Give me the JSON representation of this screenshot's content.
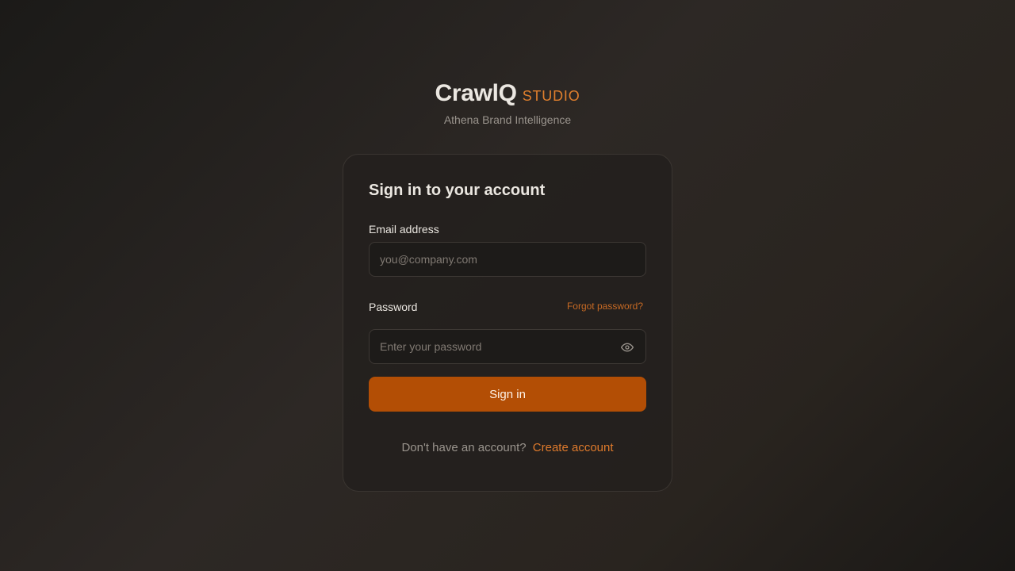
{
  "brand": {
    "name": "CrawlQ",
    "suffix": "STUDIO",
    "tagline": "Athena Brand Intelligence"
  },
  "login": {
    "title": "Sign in to your account",
    "email_label": "Email address",
    "email_placeholder": "you@company.com",
    "email_value": "",
    "password_label": "Password",
    "forgot_link": "Forgot password?",
    "password_placeholder": "Enter your password",
    "password_value": "",
    "password_toggle_icon": "eye-icon",
    "submit_label": "Sign in",
    "signup_prompt": "Don't have an account?",
    "signup_link": "Create account"
  },
  "colors": {
    "accent": "#b34e05",
    "link": "#df7a2c",
    "background": "#24211e"
  }
}
